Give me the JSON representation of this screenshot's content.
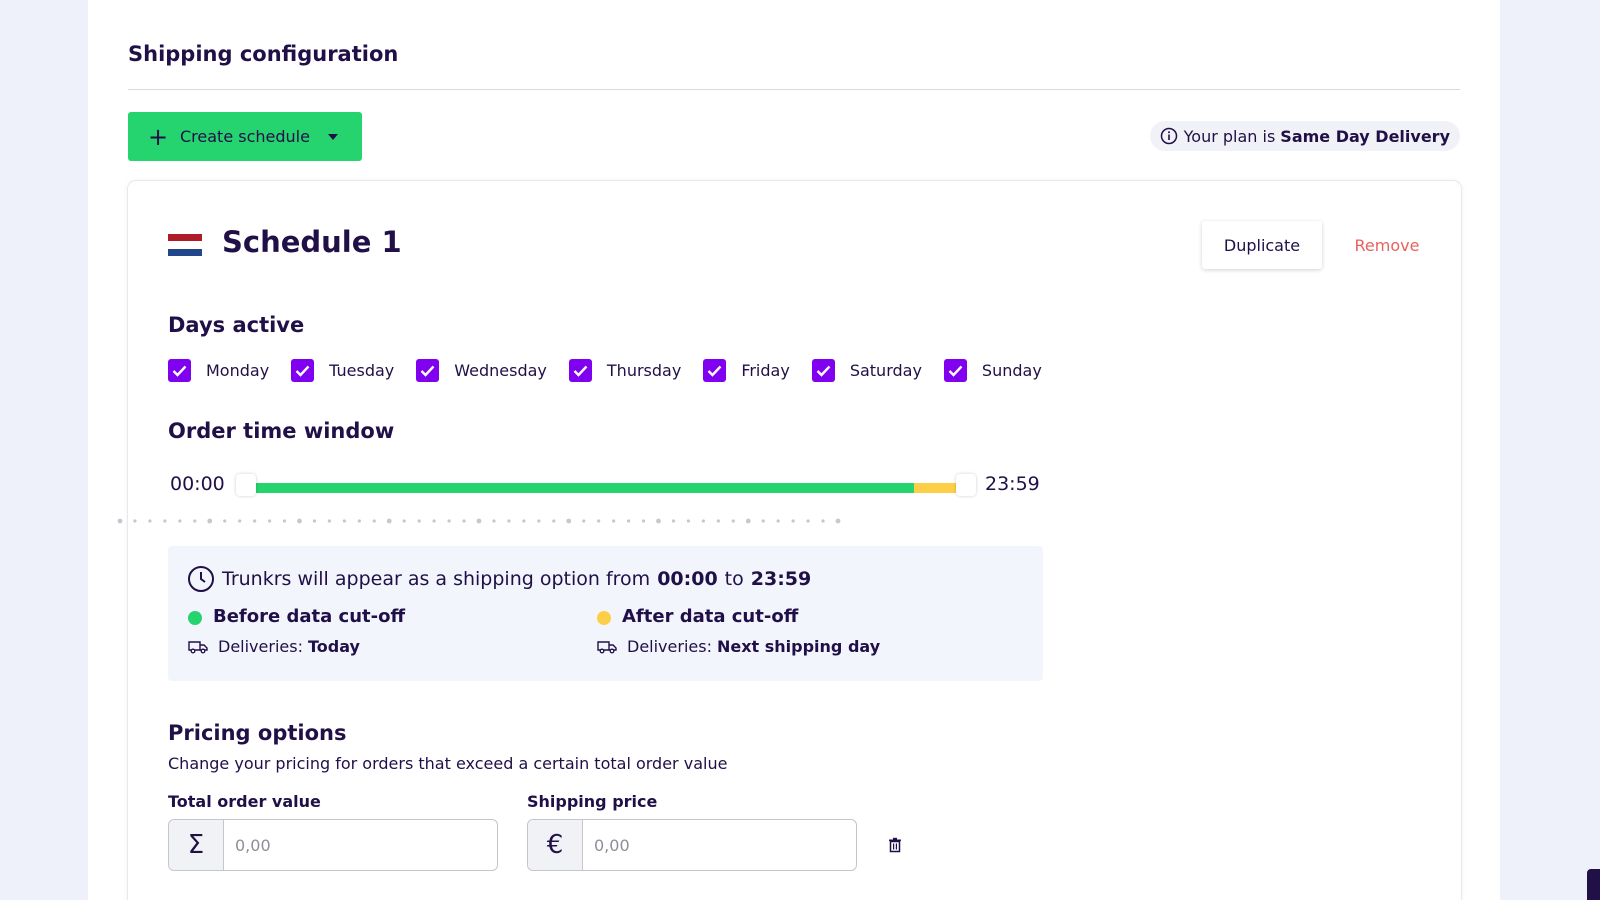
{
  "page": {
    "title": "Shipping configuration",
    "create_schedule_label": "Create schedule",
    "plan_prefix": "Your plan is",
    "plan_name": "Same Day Delivery"
  },
  "schedule": {
    "title": "Schedule 1",
    "country_flag": "netherlands-flag",
    "duplicate_label": "Duplicate",
    "remove_label": "Remove",
    "days_title": "Days active",
    "days": [
      {
        "label": "Monday",
        "checked": true
      },
      {
        "label": "Tuesday",
        "checked": true
      },
      {
        "label": "Wednesday",
        "checked": true
      },
      {
        "label": "Thursday",
        "checked": true
      },
      {
        "label": "Friday",
        "checked": true
      },
      {
        "label": "Saturday",
        "checked": true
      },
      {
        "label": "Sunday",
        "checked": true
      }
    ],
    "time_window_title": "Order time window",
    "time_start": "00:00",
    "time_end": "23:59",
    "slider": {
      "start_fraction": 0.0,
      "cutoff_fraction": 0.928,
      "end_fraction": 1.0,
      "colors": {
        "before": "#25d36f",
        "after": "#fdcf48"
      }
    },
    "info": {
      "prefix": "Trunkrs will appear as a shipping option from",
      "from": "00:00",
      "connector": "to",
      "to": "23:59",
      "before_label": "Before data cut-off",
      "before_deliveries_prefix": "Deliveries:",
      "before_deliveries_value": "Today",
      "after_label": "After data cut-off",
      "after_deliveries_prefix": "Deliveries:",
      "after_deliveries_value": "Next shipping day"
    },
    "pricing": {
      "title": "Pricing options",
      "description": "Change your pricing for orders that exceed a certain total order value",
      "total_label": "Total order value",
      "total_prefix": "Σ",
      "total_placeholder": "0,00",
      "price_label": "Shipping price",
      "price_prefix": "€",
      "price_placeholder": "0,00"
    }
  },
  "colors": {
    "primary_text": "#201047",
    "accent_green": "#25d36f",
    "accent_purple": "#8000f0",
    "remove_red": "#e8615f",
    "cutoff_yellow": "#fdcf48"
  }
}
